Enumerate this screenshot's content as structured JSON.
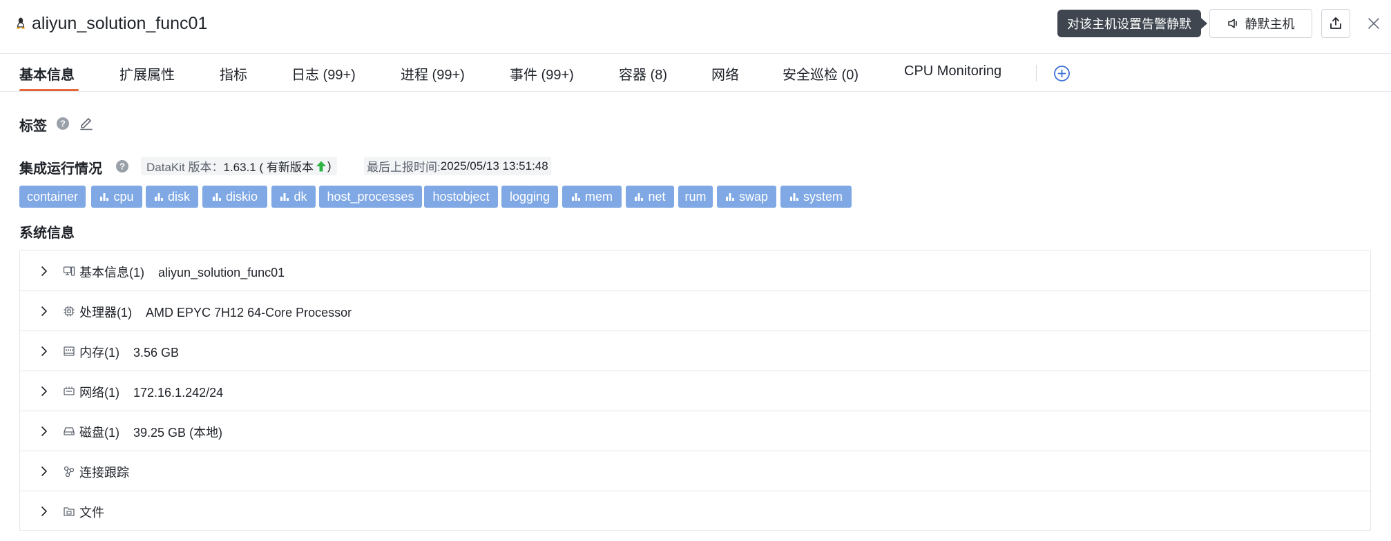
{
  "header": {
    "title": "aliyun_solution_func01",
    "tooltip": "对该主机设置告警静默",
    "mute_label": "静默主机"
  },
  "tabs": [
    {
      "label": "基本信息",
      "active": true
    },
    {
      "label": "扩展属性"
    },
    {
      "label": "指标"
    },
    {
      "label": "日志 (99+)"
    },
    {
      "label": "进程 (99+)"
    },
    {
      "label": "事件 (99+)"
    },
    {
      "label": "容器 (8)"
    },
    {
      "label": "网络"
    },
    {
      "label": "安全巡检 (0)"
    },
    {
      "label": "CPU Monitoring"
    }
  ],
  "labels_section": {
    "title": "标签"
  },
  "integration": {
    "title": "集成运行情况",
    "datakit_label": "DataKit 版本：",
    "datakit_version": "1.63.1 ( 有新版本",
    "datakit_suffix": " )",
    "report_label": "最后上报时间: ",
    "report_time": "2025/05/13 13:51:48",
    "chips": [
      {
        "label": "container",
        "icon": false
      },
      {
        "label": "cpu",
        "icon": true
      },
      {
        "label": "disk",
        "icon": true
      },
      {
        "label": "diskio",
        "icon": true
      },
      {
        "label": "dk",
        "icon": true
      },
      {
        "label": "host_processes",
        "icon": false
      },
      {
        "label": "hostobject",
        "icon": false
      },
      {
        "label": "logging",
        "icon": false
      },
      {
        "label": "mem",
        "icon": true
      },
      {
        "label": "net",
        "icon": true
      },
      {
        "label": "rum",
        "icon": false
      },
      {
        "label": "swap",
        "icon": true
      },
      {
        "label": "system",
        "icon": true
      }
    ],
    "colors": {
      "chip_bg": "#7fa8e4",
      "accent": "#e8663b",
      "upgrade": "#2fb344",
      "link_blue": "#3a6fd8"
    }
  },
  "system_info": {
    "title": "系统信息",
    "rows": [
      {
        "label": "基本信息(1)",
        "value": "aliyun_solution_func01",
        "icon": "host-icon"
      },
      {
        "label": "处理器(1)",
        "value": "AMD EPYC 7H12 64-Core Processor",
        "icon": "cpu-icon"
      },
      {
        "label": "内存(1)",
        "value": "3.56 GB",
        "icon": "memory-icon"
      },
      {
        "label": "网络(1)",
        "value": "172.16.1.242/24",
        "icon": "network-icon"
      },
      {
        "label": "磁盘(1)",
        "value": "39.25 GB (本地)",
        "icon": "disk-icon"
      },
      {
        "label": "连接跟踪",
        "value": "",
        "icon": "connection-icon"
      },
      {
        "label": "文件",
        "value": "",
        "icon": "file-icon"
      }
    ]
  }
}
